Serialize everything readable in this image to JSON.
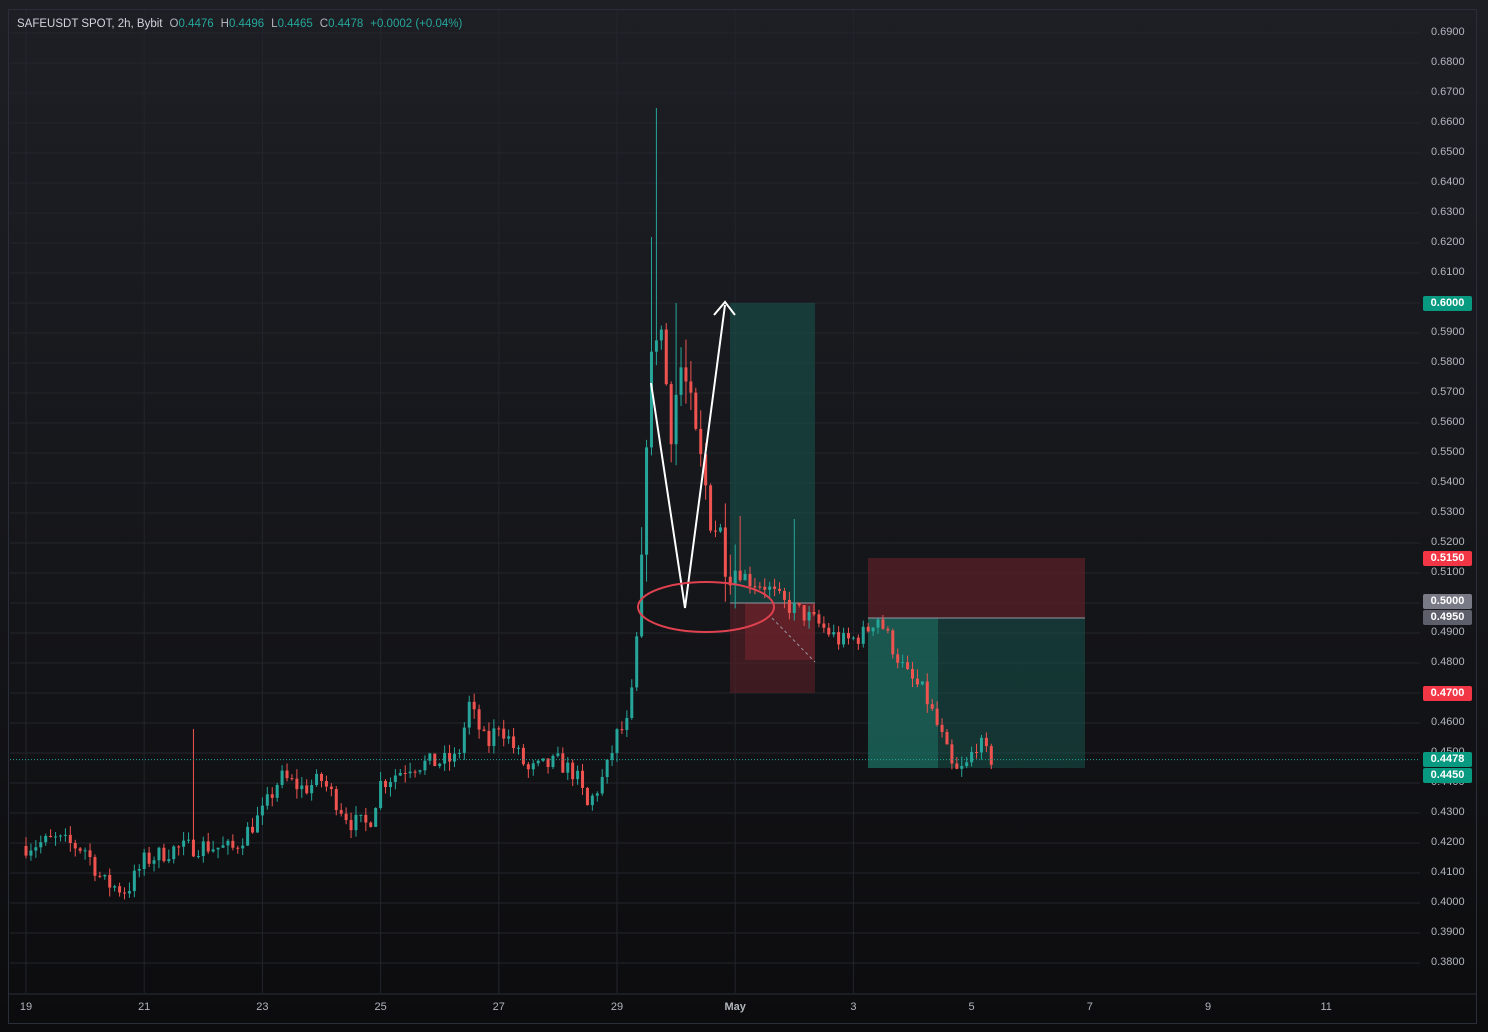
{
  "header": {
    "symbol": "SAFEUSDT SPOT, 2h, Bybit",
    "open_key": "O",
    "open": "0.4476",
    "high_key": "H",
    "high": "0.4496",
    "low_key": "L",
    "low": "0.4465",
    "close_key": "C",
    "close": "0.4478",
    "change": "+0.0002 (+0.04%)"
  },
  "y_axis": {
    "ticks": [
      "0.6900",
      "0.6800",
      "0.6700",
      "0.6600",
      "0.6500",
      "0.6400",
      "0.6300",
      "0.6200",
      "0.6100",
      "0.5900",
      "0.5800",
      "0.5700",
      "0.5600",
      "0.5500",
      "0.5400",
      "0.5300",
      "0.5200",
      "0.5100",
      "0.4900",
      "0.4800",
      "0.4600",
      "0.4500",
      "0.4400",
      "0.4300",
      "0.4200",
      "0.4100",
      "0.4000",
      "0.3900",
      "0.3800"
    ],
    "range": [
      0.372,
      0.699
    ]
  },
  "x_axis": {
    "ticks": [
      "19",
      "21",
      "23",
      "25",
      "27",
      "29",
      "May",
      "3",
      "5",
      "7",
      "9",
      "11"
    ]
  },
  "price_labels": [
    {
      "text": "0.6000",
      "value": 0.6,
      "color": "#089981"
    },
    {
      "text": "0.5150",
      "value": 0.515,
      "color": "#f23645"
    },
    {
      "text": "0.5000",
      "value": 0.5,
      "color": "#787b86"
    },
    {
      "text": "0.4950",
      "value": 0.495,
      "color": "#5d606b"
    },
    {
      "text": "0.4700",
      "value": 0.47,
      "color": "#f23645"
    },
    {
      "text": "0.4478",
      "value": 0.4478,
      "color": "#089981"
    },
    {
      "text": "0.4450",
      "value": 0.445,
      "color": "#089981"
    }
  ],
  "colors": {
    "up": "#26a69a",
    "down": "#ef5350",
    "grid": "#22252c",
    "profit_zone": "#16574f",
    "loss_zone": "#5a1f27",
    "annotation": "#ffffff",
    "ellipse": "#e0414f"
  },
  "chart_data": {
    "type": "candlestick",
    "symbol": "SAFEUSDT",
    "interval": "2h",
    "exchange": "Bybit",
    "last_price": 0.4478,
    "approximate_close_path": [
      [
        "19",
        0.419
      ],
      [
        "20",
        0.407
      ],
      [
        "21",
        0.418
      ],
      [
        "22",
        0.419
      ],
      [
        "23",
        0.443
      ],
      [
        "24",
        0.432
      ],
      [
        "25",
        0.447
      ],
      [
        "26",
        0.449
      ],
      [
        "27",
        0.448
      ],
      [
        "28",
        0.433
      ],
      [
        "29",
        0.455
      ],
      [
        "29.5",
        0.575
      ],
      [
        "30",
        0.535
      ],
      [
        "30.5",
        0.505
      ],
      [
        "May",
        0.505
      ],
      [
        "2",
        0.485
      ],
      [
        "3",
        0.495
      ],
      [
        "4",
        0.465
      ],
      [
        "4.5",
        0.44
      ],
      [
        "5",
        0.448
      ]
    ],
    "trade_positions": [
      {
        "side": "long",
        "entry": 0.5,
        "target": 0.6,
        "stop": 0.47
      },
      {
        "side": "short",
        "entry": 0.495,
        "target": 0.445,
        "stop": 0.515
      }
    ],
    "grid": true
  }
}
